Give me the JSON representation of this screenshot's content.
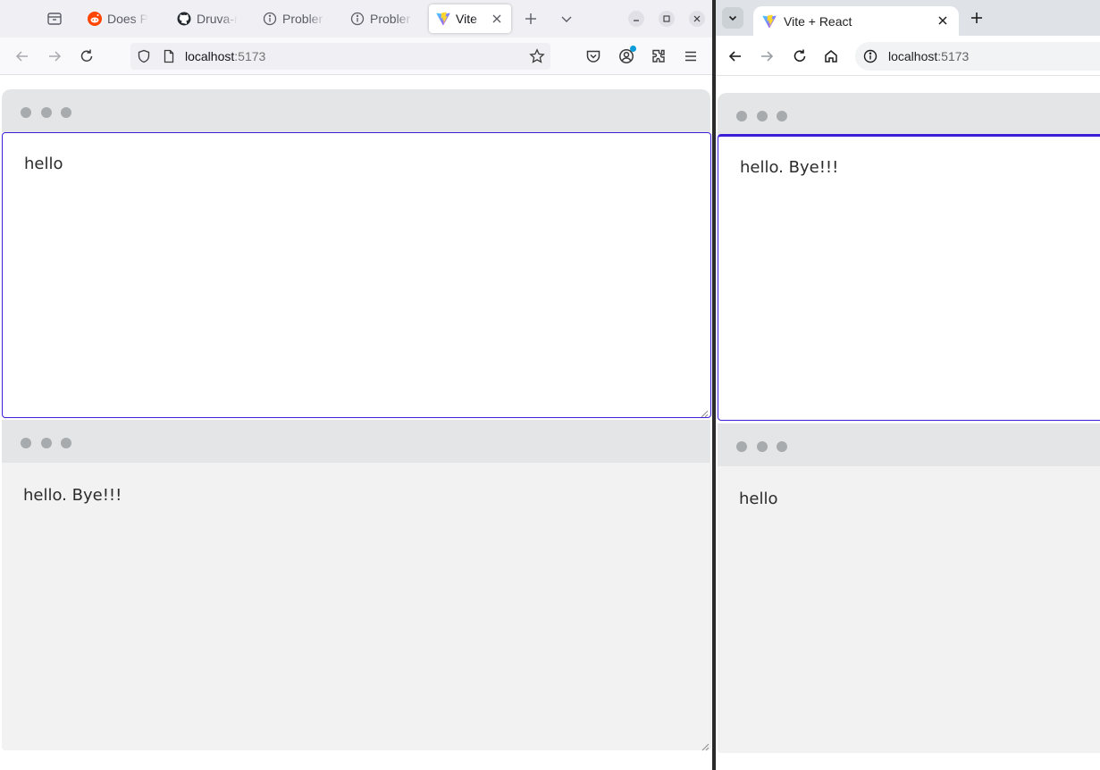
{
  "firefox": {
    "tabs": [
      {
        "title": "Does Pl"
      },
      {
        "title": "Druva-r"
      },
      {
        "title": "Probler"
      },
      {
        "title": "Probler"
      },
      {
        "title": "Vite"
      }
    ],
    "url_host": "localhost",
    "url_port": ":5173",
    "editor_text": "hello",
    "preview_text": "hello. Bye!!!"
  },
  "chrome": {
    "tab_title": "Vite + React",
    "url_host": "localhost",
    "url_port": ":5173",
    "editor_text": "hello. Bye!!!",
    "preview_text": "hello"
  },
  "colors": {
    "focus_border": "#3c1fd6",
    "pane_header": "#e4e5e6",
    "preview_bg": "#f2f2f2"
  }
}
